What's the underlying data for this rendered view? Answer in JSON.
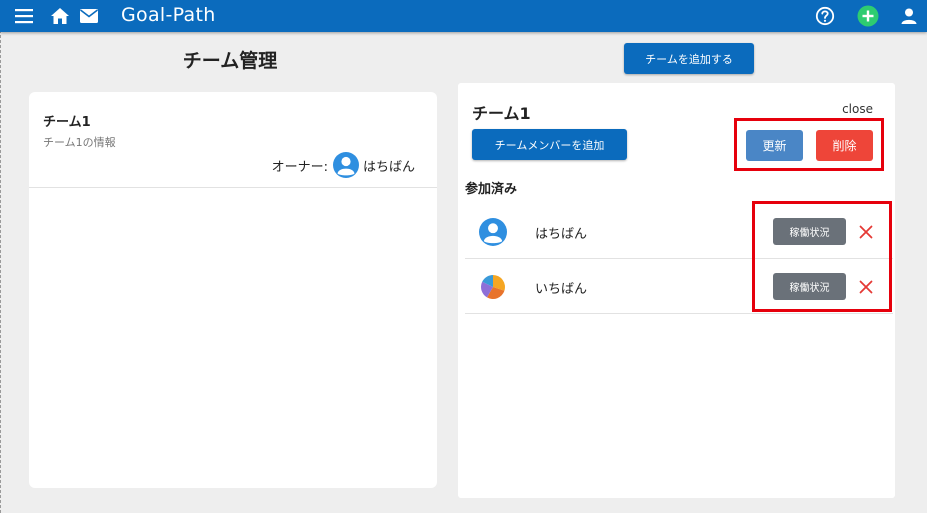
{
  "app": {
    "title": "Goal-Path"
  },
  "topbar": {
    "icons": [
      "menu-icon",
      "home-icon",
      "mail-icon",
      "help-icon",
      "add-circle-icon",
      "account-icon"
    ],
    "accent": "#0b6bbd"
  },
  "page": {
    "title": "チーム管理",
    "add_team_label": "チームを追加する"
  },
  "teams": [
    {
      "name": "チーム1",
      "description": "チーム1の情報",
      "owner_label": "オーナー:",
      "owner_name": "はちばん"
    }
  ],
  "detail": {
    "title": "チーム1",
    "close_label": "close",
    "add_member_label": "チームメンバーを追加",
    "update_label": "更新",
    "delete_label": "削除",
    "joined_label": "参加済み",
    "members": [
      {
        "name": "はちばん",
        "avatar": "user-avatar-icon",
        "status_label": "稼働状況"
      },
      {
        "name": "いちばん",
        "avatar": "pie-avatar-icon",
        "status_label": "稼働状況"
      }
    ]
  },
  "colors": {
    "primary": "#0b6bbd",
    "update": "#4a86c6",
    "delete": "#ee4539",
    "status": "#6a7179",
    "highlight": "#e6000c",
    "remove": "#e53935"
  }
}
